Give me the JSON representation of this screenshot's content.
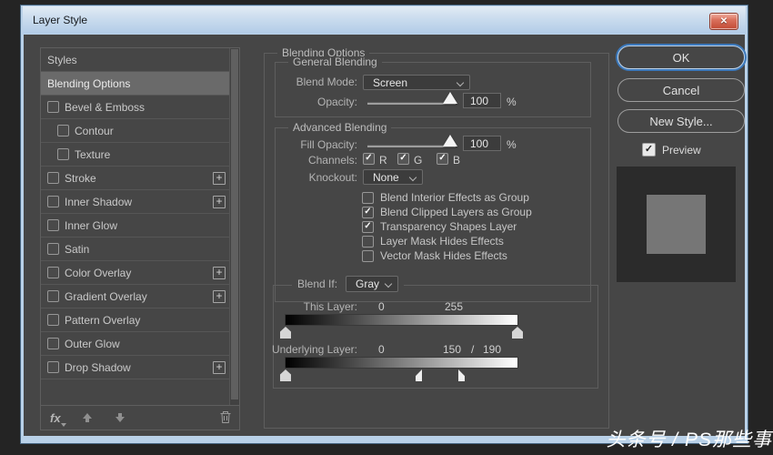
{
  "window": {
    "title": "Layer Style",
    "close_glyph": "✕"
  },
  "sidebar": {
    "items": [
      {
        "label": "Styles",
        "checkbox": false,
        "checked": false,
        "indent": false,
        "plus": false,
        "selected": false
      },
      {
        "label": "Blending Options",
        "checkbox": false,
        "checked": false,
        "indent": false,
        "plus": false,
        "selected": true
      },
      {
        "label": "Bevel & Emboss",
        "checkbox": true,
        "checked": false,
        "indent": false,
        "plus": false,
        "selected": false
      },
      {
        "label": "Contour",
        "checkbox": true,
        "checked": false,
        "indent": true,
        "plus": false,
        "selected": false
      },
      {
        "label": "Texture",
        "checkbox": true,
        "checked": false,
        "indent": true,
        "plus": false,
        "selected": false
      },
      {
        "label": "Stroke",
        "checkbox": true,
        "checked": false,
        "indent": false,
        "plus": true,
        "selected": false
      },
      {
        "label": "Inner Shadow",
        "checkbox": true,
        "checked": false,
        "indent": false,
        "plus": true,
        "selected": false
      },
      {
        "label": "Inner Glow",
        "checkbox": true,
        "checked": false,
        "indent": false,
        "plus": false,
        "selected": false
      },
      {
        "label": "Satin",
        "checkbox": true,
        "checked": false,
        "indent": false,
        "plus": false,
        "selected": false
      },
      {
        "label": "Color Overlay",
        "checkbox": true,
        "checked": false,
        "indent": false,
        "plus": true,
        "selected": false
      },
      {
        "label": "Gradient Overlay",
        "checkbox": true,
        "checked": false,
        "indent": false,
        "plus": true,
        "selected": false
      },
      {
        "label": "Pattern Overlay",
        "checkbox": true,
        "checked": false,
        "indent": false,
        "plus": false,
        "selected": false
      },
      {
        "label": "Outer Glow",
        "checkbox": true,
        "checked": false,
        "indent": false,
        "plus": false,
        "selected": false
      },
      {
        "label": "Drop Shadow",
        "checkbox": true,
        "checked": false,
        "indent": false,
        "plus": true,
        "selected": false
      }
    ],
    "footer": {
      "fx_label": "fx"
    }
  },
  "main": {
    "panel_title": "Blending Options",
    "general": {
      "title": "General Blending",
      "blend_mode_label": "Blend Mode:",
      "blend_mode_value": "Screen",
      "opacity_label": "Opacity:",
      "opacity_value": "100",
      "percent": "%"
    },
    "advanced": {
      "title": "Advanced Blending",
      "fill_opacity_label": "Fill Opacity:",
      "fill_opacity_value": "100",
      "percent": "%",
      "channels_label": "Channels:",
      "channels": [
        {
          "label": "R",
          "checked": true
        },
        {
          "label": "G",
          "checked": true
        },
        {
          "label": "B",
          "checked": true
        }
      ],
      "knockout_label": "Knockout:",
      "knockout_value": "None",
      "group_checkboxes": [
        {
          "label": "Blend Interior Effects as Group",
          "checked": false
        },
        {
          "label": "Blend Clipped Layers as Group",
          "checked": true
        },
        {
          "label": "Transparency Shapes Layer",
          "checked": true
        },
        {
          "label": "Layer Mask Hides Effects",
          "checked": false
        },
        {
          "label": "Vector Mask Hides Effects",
          "checked": false
        }
      ]
    },
    "blend_if": {
      "label": "Blend If:",
      "channel": "Gray",
      "range_max": 255,
      "this_layer": {
        "label": "This Layer:",
        "black": 0,
        "white": 255
      },
      "underlying": {
        "label": "Underlying Layer:",
        "black": 0,
        "white_split_low": 150,
        "separator": "/",
        "white_split_high": 190
      }
    }
  },
  "actions": {
    "ok": "OK",
    "cancel": "Cancel",
    "new_style": "New Style...",
    "preview_label": "Preview",
    "preview_checked": true,
    "preview_check_glyph": "✓"
  },
  "watermark": "头条号 / PS那些事"
}
